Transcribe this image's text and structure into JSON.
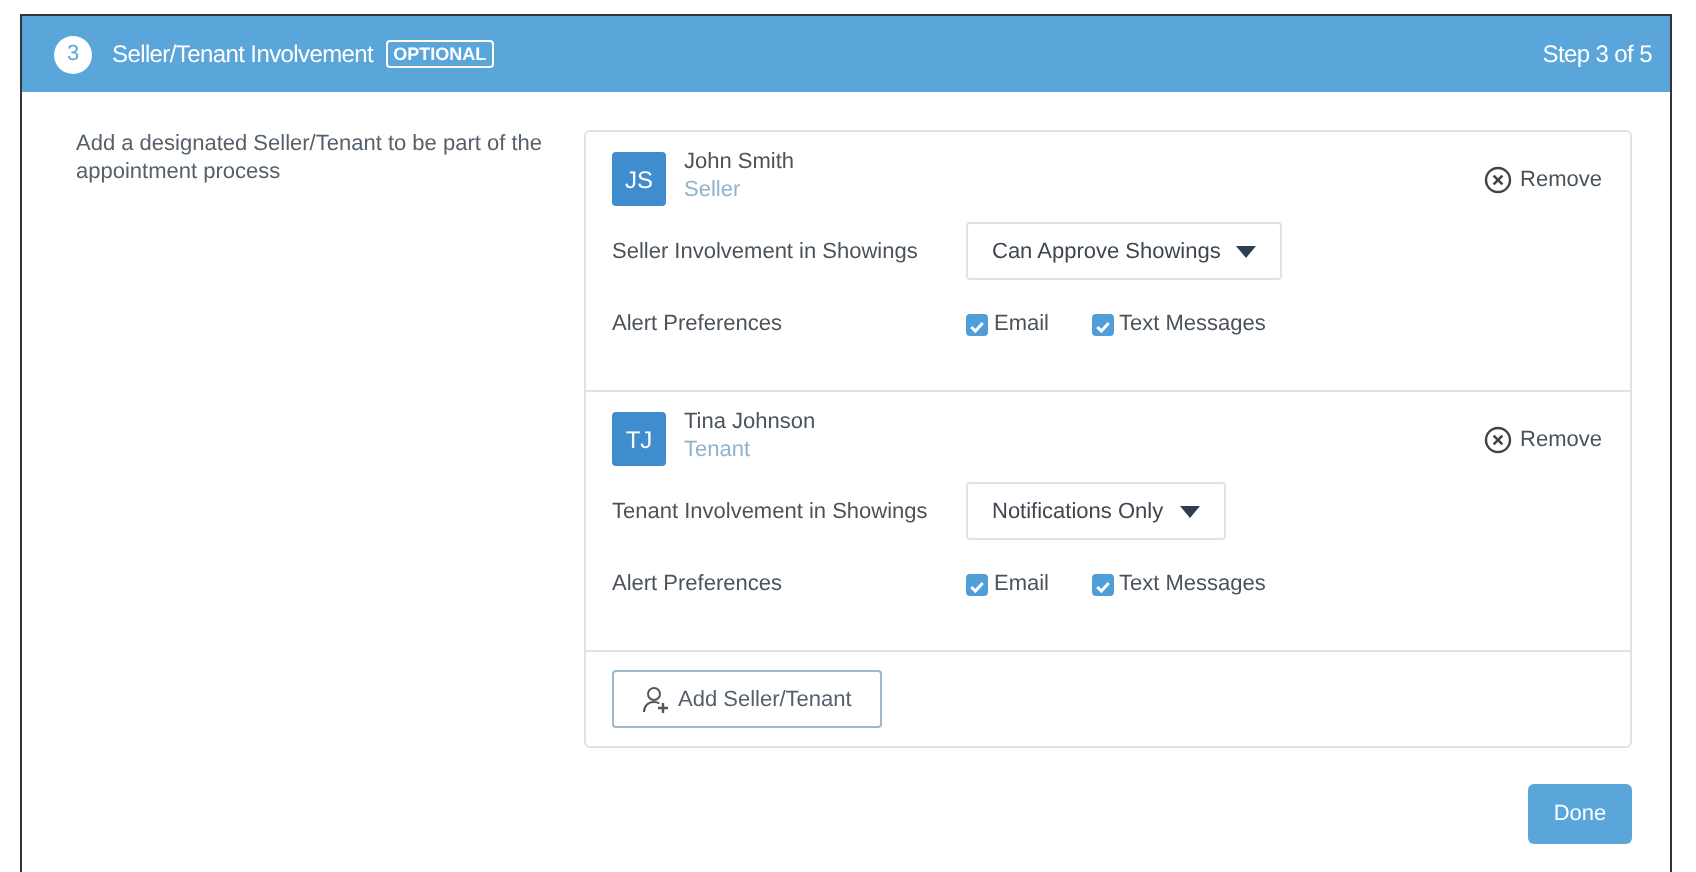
{
  "header": {
    "step_number": "3",
    "title": "Seller/Tenant Involvement",
    "badge": "OPTIONAL",
    "progress": "Step 3 of 5"
  },
  "description": "Add a designated Seller/Tenant to be part of the appointment process",
  "people": [
    {
      "initials": "JS",
      "name": "John Smith",
      "role": "Seller",
      "remove": "Remove",
      "involvement_label": "Seller Involvement in Showings",
      "involvement": "Can Approve Showings",
      "alerts_label": "Alert Preferences",
      "alerts": [
        {
          "label": "Email",
          "checked": true
        },
        {
          "label": "Text Messages",
          "checked": true
        }
      ]
    },
    {
      "initials": "TJ",
      "name": "Tina Johnson",
      "role": "Tenant",
      "remove": "Remove",
      "involvement_label": "Tenant Involvement in Showings",
      "involvement": "Notifications Only",
      "alerts_label": "Alert Preferences",
      "alerts": [
        {
          "label": "Email",
          "checked": true
        },
        {
          "label": "Text Messages",
          "checked": true
        }
      ]
    }
  ],
  "add_button": "Add Seller/Tenant",
  "done_button": "Done"
}
